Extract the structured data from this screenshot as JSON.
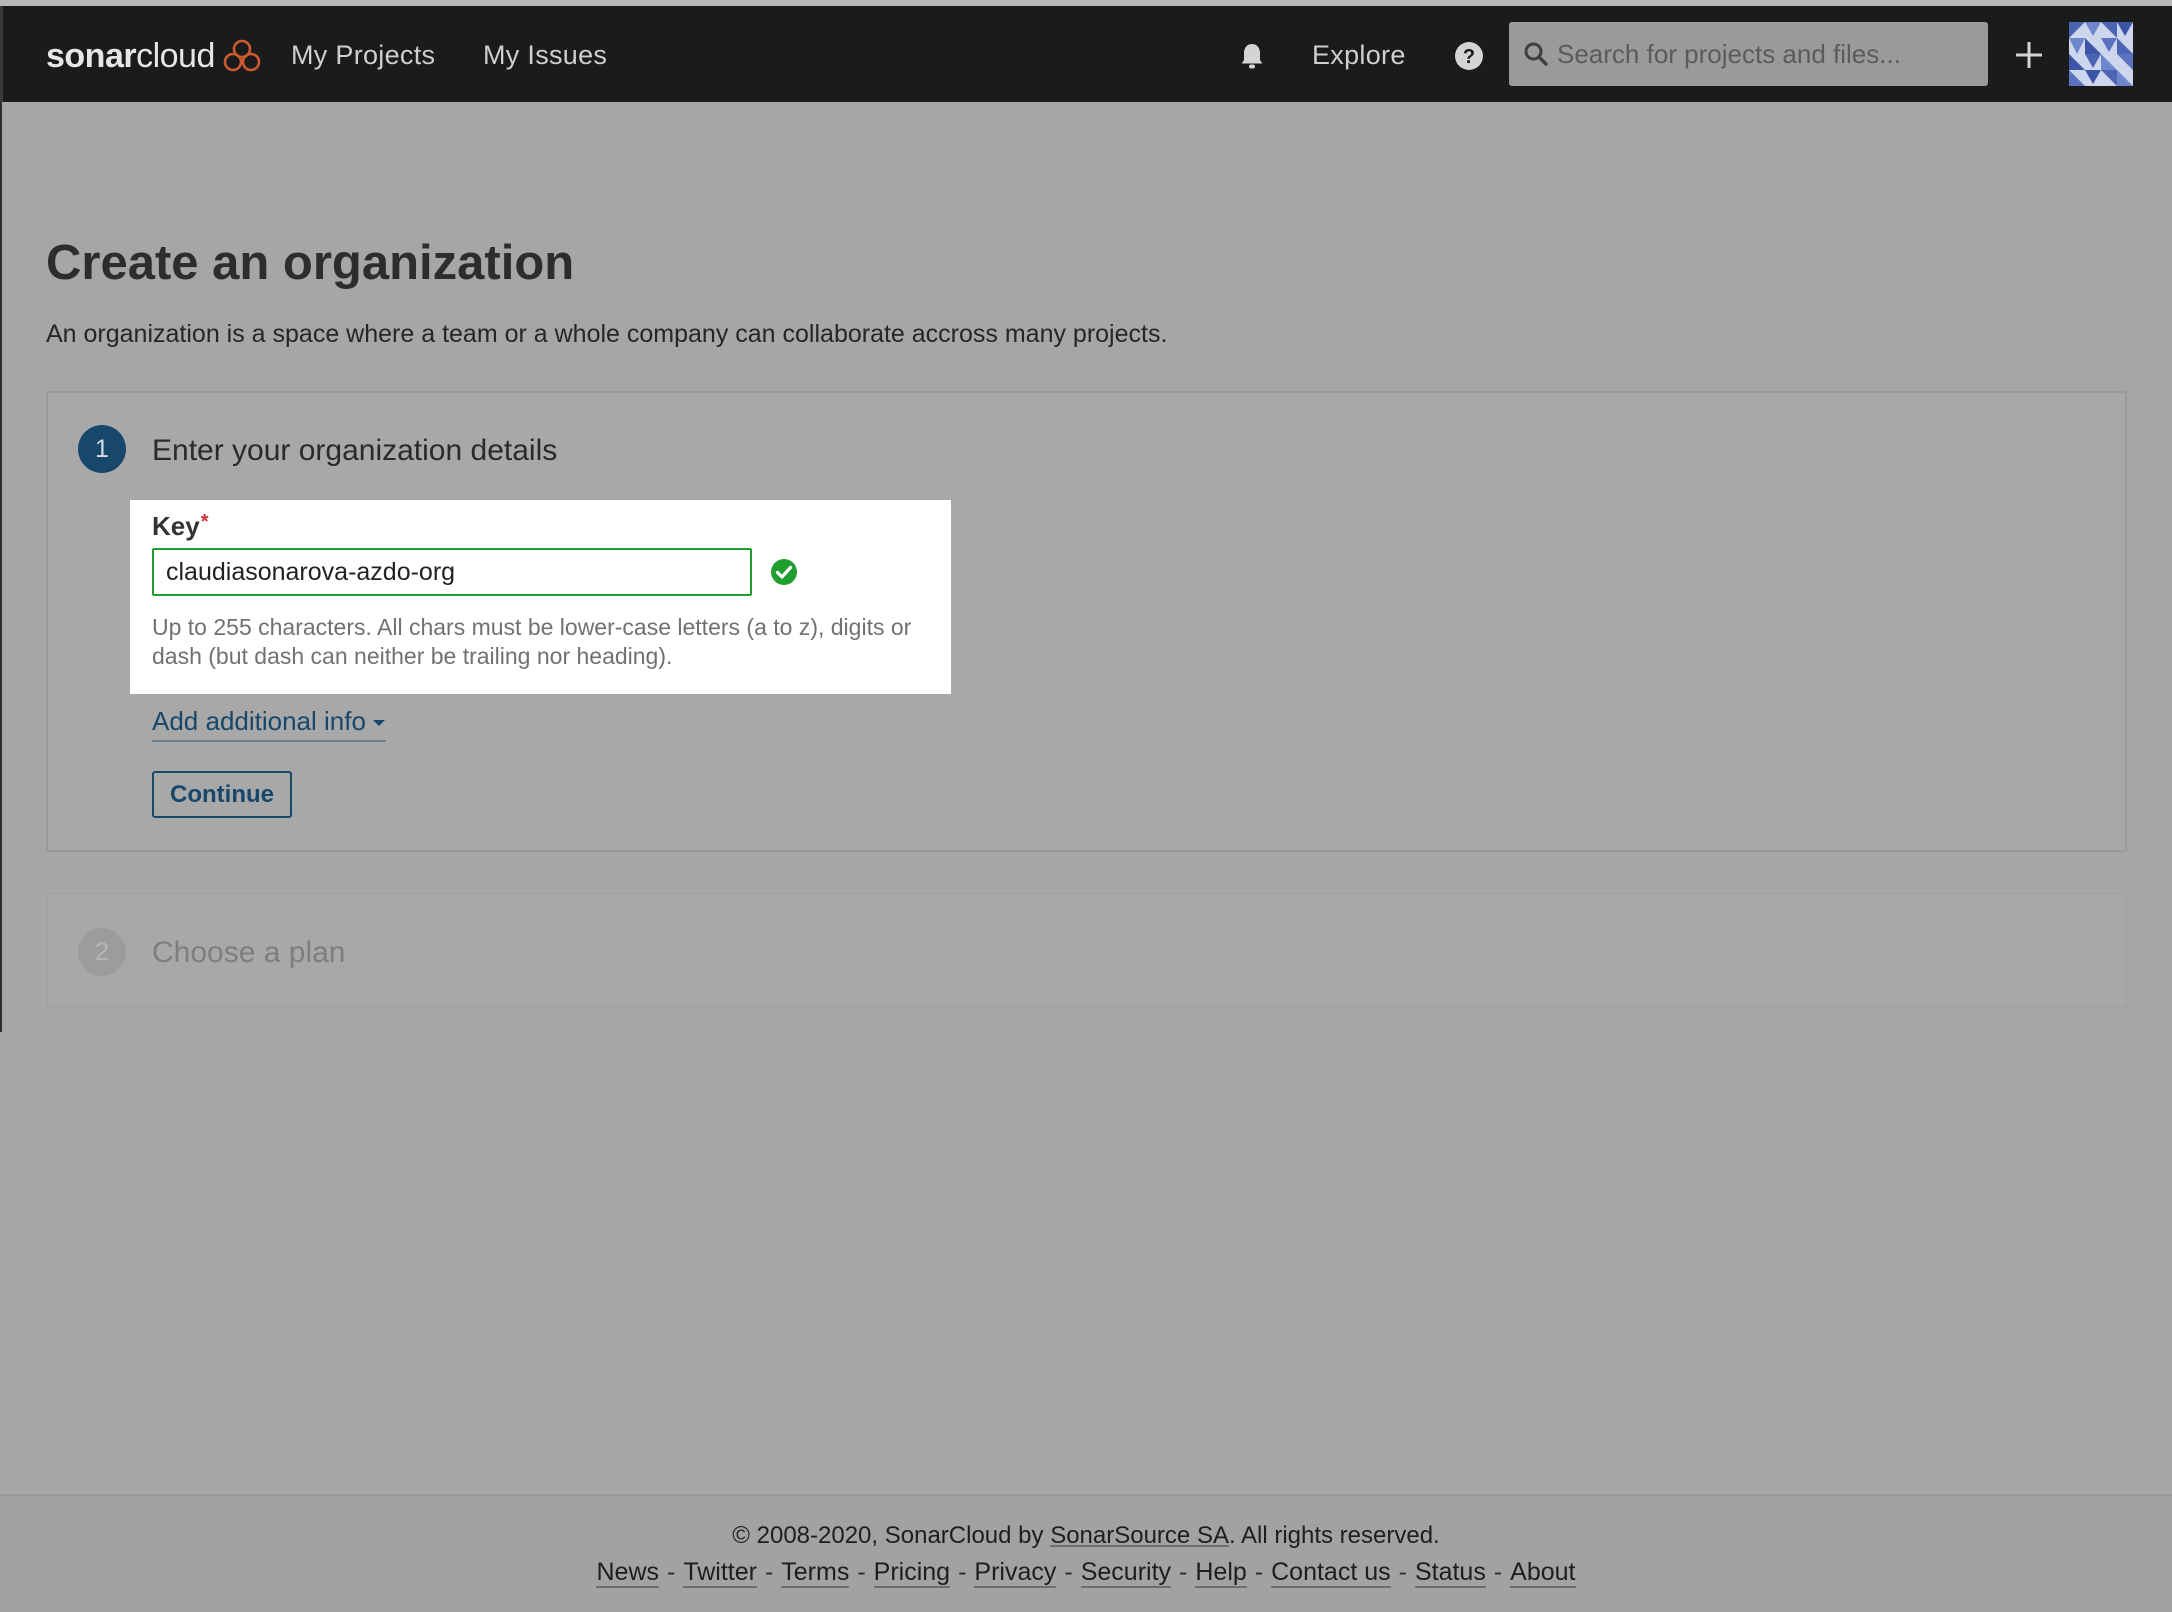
{
  "header": {
    "logo_text_bold": "sonar",
    "logo_text": "cloud",
    "nav": [
      {
        "label": "My Projects"
      },
      {
        "label": "My Issues"
      }
    ],
    "explore_label": "Explore",
    "search_placeholder": "Search for projects and files..."
  },
  "page": {
    "title": "Create an organization",
    "description": "An organization is a space where a team or a whole company can collaborate accross many projects."
  },
  "step1": {
    "number": "1",
    "title": "Enter your organization details",
    "key_label": "Key",
    "required_mark": "*",
    "key_value": "claudiasonarova-azdo-org",
    "key_help": "Up to 255 characters. All chars must be lower-case letters (a to z), digits or dash (but dash can neither be trailing nor heading).",
    "add_info_label": "Add additional info",
    "continue_label": "Continue"
  },
  "step2": {
    "number": "2",
    "title": "Choose a plan"
  },
  "footer": {
    "copyright_prefix": "© 2008-2020, SonarCloud by ",
    "copyright_link": "SonarSource SA",
    "copyright_suffix": ". All rights reserved.",
    "links": [
      "News",
      "Twitter",
      "Terms",
      "Pricing",
      "Privacy",
      "Security",
      "Help",
      "Contact us",
      "Status",
      "About"
    ],
    "separator": "-"
  },
  "colors": {
    "navbar": "#1b1b1b",
    "accent": "#17476b",
    "valid": "#1f9f2d",
    "logo_cloud": "#cc5a2e"
  }
}
